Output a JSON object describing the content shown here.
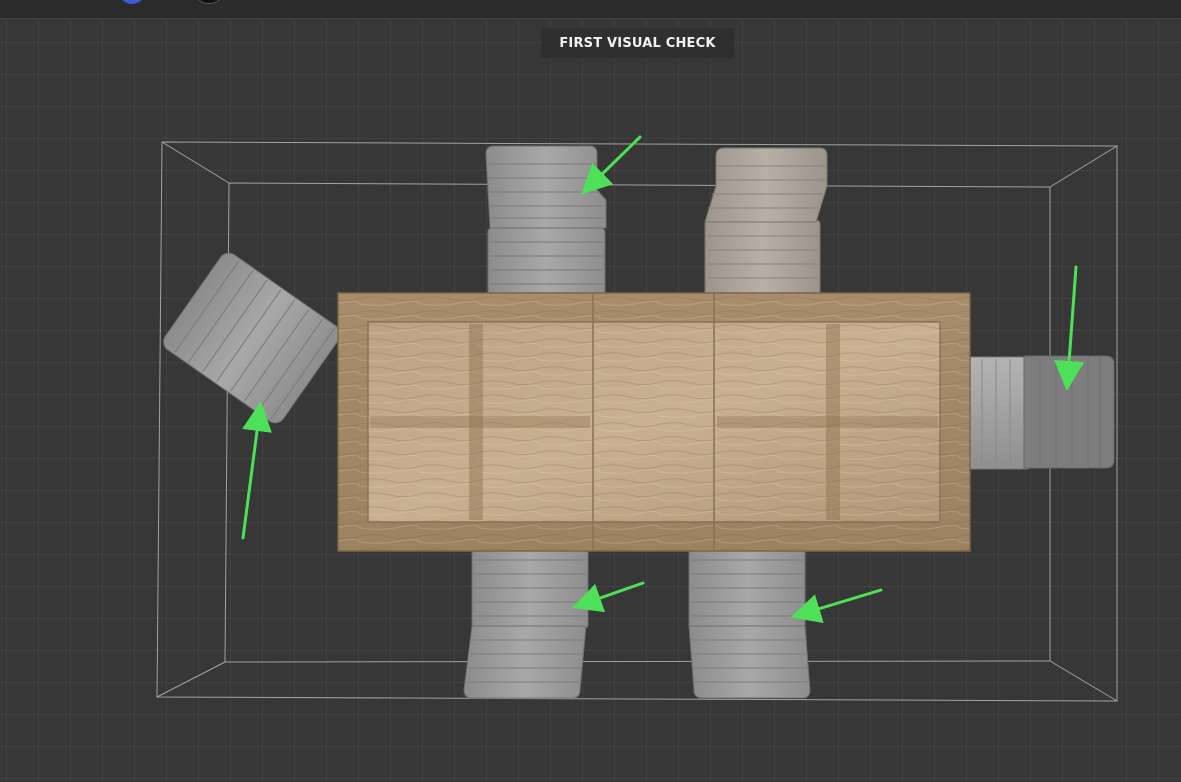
{
  "viewer": {
    "badge_label": "FIRST VISUAL CHECK"
  },
  "colors": {
    "background": "#373737",
    "grid": "#444444",
    "bounding_box": "#bdbdbd",
    "table_wood": "#b69c7c",
    "chair_fabric": "#9a9a9a",
    "arrow": "#4fe05a"
  },
  "icons": [
    "bounding-box-icon",
    "arrow-annotation-icon"
  ]
}
